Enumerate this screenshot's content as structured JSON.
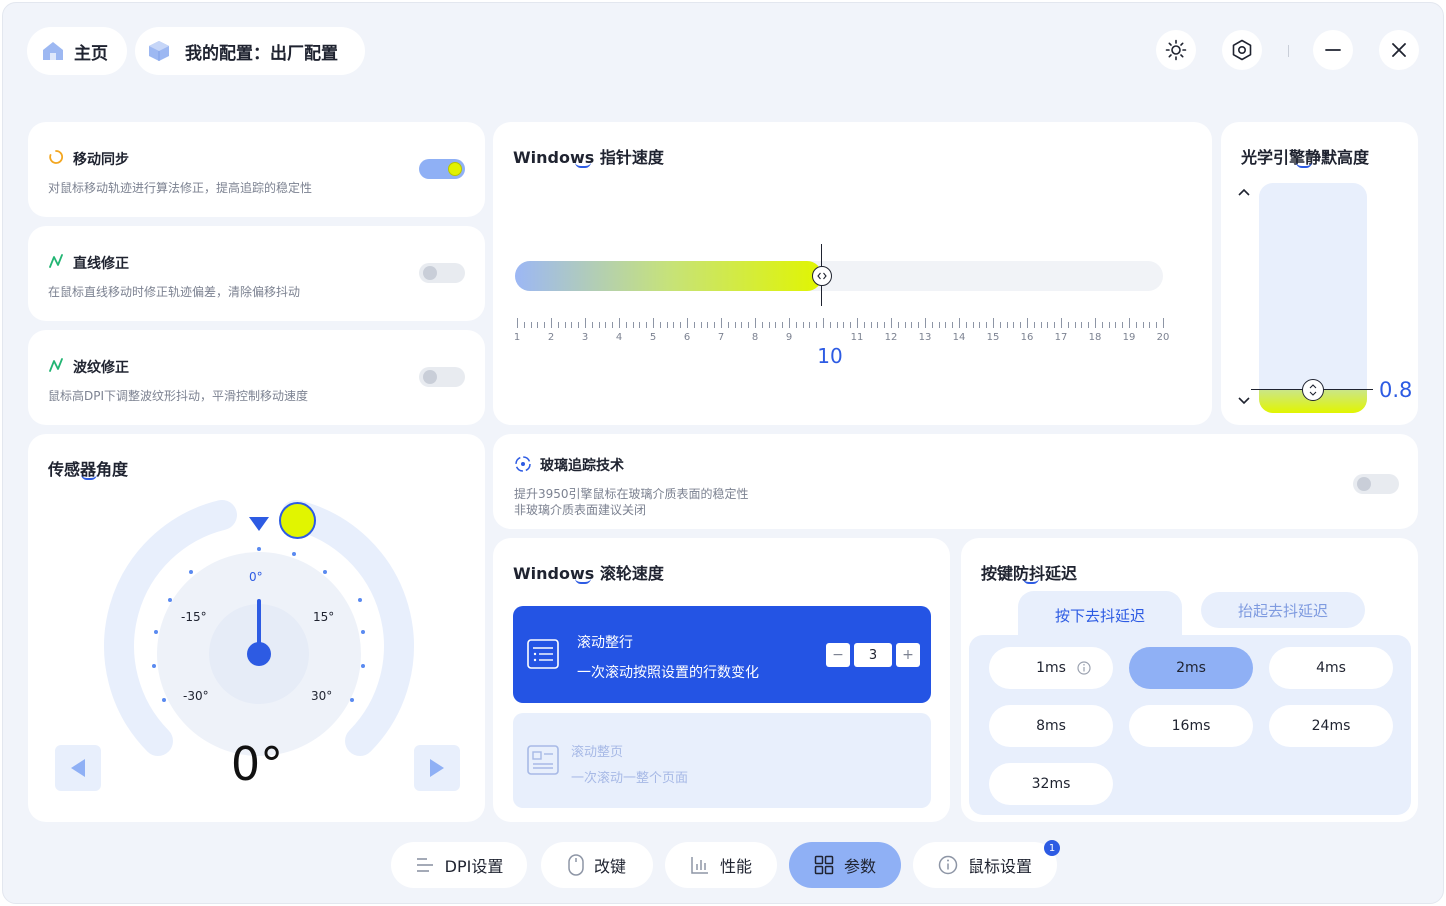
{
  "header": {
    "home_label": "主页",
    "config_label": "我的配置：出厂配置"
  },
  "toggles": [
    {
      "title": "移动同步",
      "desc": "对鼠标移动轨迹进行算法修正，提高追踪的稳定性",
      "on": true
    },
    {
      "title": "直线修正",
      "desc": "在鼠标直线移动时修正轨迹偏差，清除偏移抖动",
      "on": false
    },
    {
      "title": "波纹修正",
      "desc": "鼠标高DPI下调整波纹形抖动，平滑控制移动速度",
      "on": false
    }
  ],
  "pointer_speed": {
    "title": "Windows 指针速度",
    "value": "10",
    "min": 1,
    "max": 20,
    "ticks": [
      "1",
      "2",
      "3",
      "4",
      "5",
      "6",
      "7",
      "8",
      "9",
      "10",
      "11",
      "12",
      "13",
      "14",
      "15",
      "16",
      "17",
      "18",
      "19",
      "20"
    ]
  },
  "lod": {
    "title": "光学引擎静默高度",
    "value": "0.8"
  },
  "sensor_angle": {
    "title": "传感器角度",
    "value": "0°",
    "labels": {
      "zero": "0°",
      "m15": "-15°",
      "p15": "15°",
      "m30": "-30°",
      "p30": "30°"
    }
  },
  "glass": {
    "title": "玻璃追踪技术",
    "desc1": "提升3950引擎鼠标在玻璃介质表面的稳定性",
    "desc2": "非玻璃介质表面建议关闭",
    "on": false
  },
  "scroll": {
    "title": "Windows 滚轮速度",
    "line_title": "滚动整行",
    "line_desc": "一次滚动按照设置的行数变化",
    "line_value": "3",
    "minus": "−",
    "plus": "+",
    "page_title": "滚动整页",
    "page_desc": "一次滚动一整个页面"
  },
  "debounce": {
    "title": "按键防抖延迟",
    "tab_press": "按下去抖延迟",
    "tab_release": "抬起去抖延迟",
    "options": [
      "1ms",
      "2ms",
      "4ms",
      "8ms",
      "16ms",
      "24ms",
      "32ms"
    ],
    "selected": "2ms"
  },
  "nav": {
    "dpi": "DPI设置",
    "remap": "改键",
    "perf": "性能",
    "params": "参数",
    "mouse": "鼠标设置",
    "mouse_badge": "1"
  },
  "colors": {
    "accent": "#2d5be3",
    "highlight": "#e1f200",
    "selected": "#8fb0f5"
  }
}
